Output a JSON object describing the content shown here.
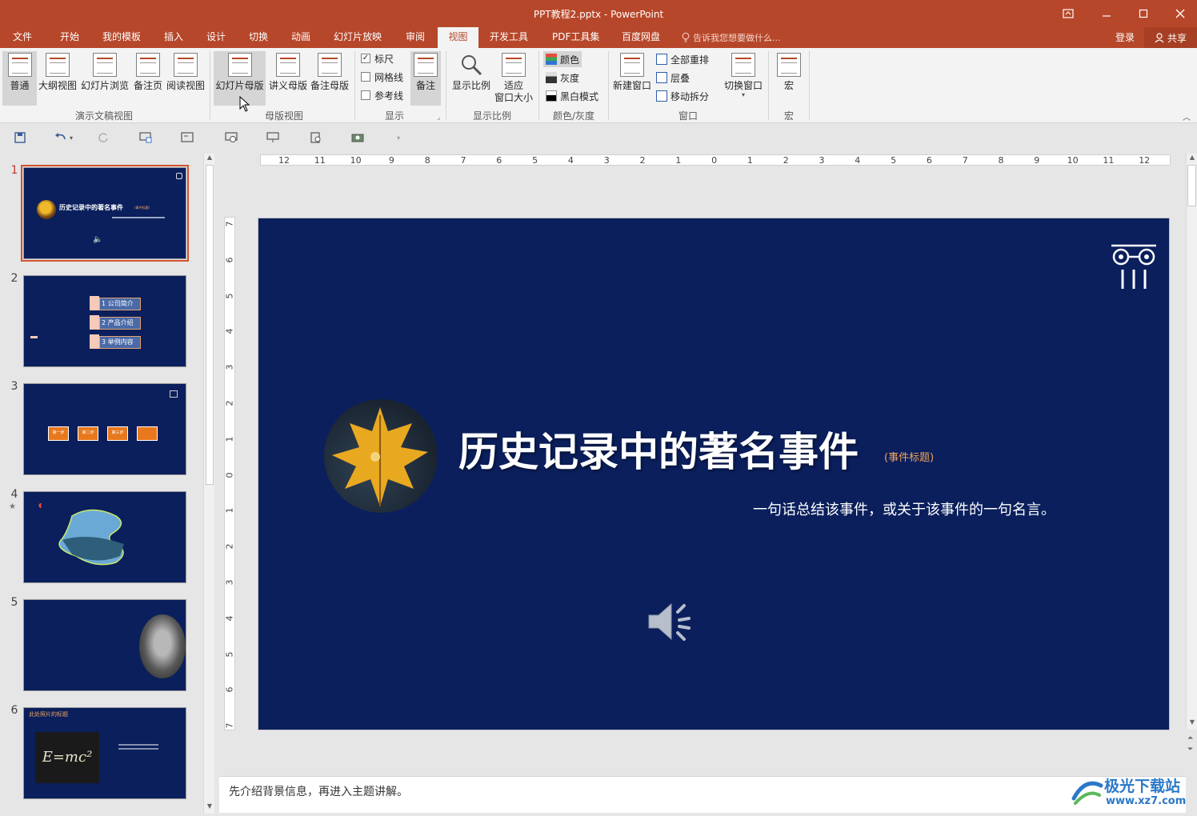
{
  "window": {
    "title": "PPT教程2.pptx - PowerPoint"
  },
  "tabs": [
    "文件",
    "开始",
    "我的模板",
    "插入",
    "设计",
    "切换",
    "动画",
    "幻灯片放映",
    "审阅",
    "视图",
    "开发工具",
    "PDF工具集",
    "百度网盘"
  ],
  "active_tab_index": 9,
  "tellme": "告诉我您想要做什么...",
  "account": {
    "signin": "登录",
    "share": "共享"
  },
  "ribbon": {
    "presentation_views": {
      "group": "演示文稿视图",
      "buttons": [
        "普通",
        "大纲视图",
        "幻灯片浏览",
        "备注页",
        "阅读视图"
      ]
    },
    "master_views": {
      "group": "母版视图",
      "buttons": [
        "幻灯片母版",
        "讲义母版",
        "备注母版"
      ]
    },
    "show": {
      "group": "显示",
      "checks": [
        {
          "label": "标尺",
          "checked": true
        },
        {
          "label": "网格线",
          "checked": false
        },
        {
          "label": "参考线",
          "checked": false
        }
      ],
      "notes_button": "备注"
    },
    "zoom": {
      "group": "显示比例",
      "zoom": "显示比例",
      "fit_line1": "适应",
      "fit_line2": "窗口大小"
    },
    "color": {
      "group": "颜色/灰度",
      "items": [
        "颜色",
        "灰度",
        "黑白模式"
      ]
    },
    "window_grp": {
      "group": "窗口",
      "new_window": "新建窗口",
      "arrange_all": "全部重排",
      "cascade": "层叠",
      "move_split": "移动拆分",
      "switch_windows": "切换窗口"
    },
    "macros": {
      "group": "宏",
      "button": "宏"
    }
  },
  "thumbnails": [
    {
      "num": "1",
      "title": "历史记录中的著名事件",
      "tag": "(事件标题)"
    },
    {
      "num": "2",
      "items": [
        "1 公司简介",
        "2 产品介绍",
        "3 举例内容"
      ]
    },
    {
      "num": "3",
      "steps": [
        "第一步",
        "第二步",
        "第三步"
      ]
    },
    {
      "num": "4"
    },
    {
      "num": "5"
    },
    {
      "num": "6",
      "title": "此处照片的标题",
      "formula": "E=mc²"
    }
  ],
  "slide": {
    "title": "历史记录中的著名事件",
    "subtitle_tag": "(事件标题)",
    "quote": "一句话总结该事件，或关于该事件的一句名言。"
  },
  "notes": "先介绍背景信息，再进入主题讲解。",
  "rulers": {
    "h": [
      "12",
      "11",
      "10",
      "9",
      "8",
      "7",
      "6",
      "5",
      "4",
      "3",
      "2",
      "1",
      "0",
      "1",
      "2",
      "3",
      "4",
      "5",
      "6",
      "7",
      "8",
      "9",
      "10",
      "11",
      "12"
    ],
    "v": [
      "7",
      "6",
      "5",
      "4",
      "3",
      "2",
      "1",
      "0",
      "1",
      "2",
      "3",
      "4",
      "5",
      "6",
      "7"
    ]
  },
  "watermark": {
    "line1": "极光下载站",
    "line2": "www.xz7.com"
  },
  "colors": {
    "accent": "#b7472a",
    "slide_bg": "#0a1f5c",
    "highlight": "#f0a35a"
  }
}
